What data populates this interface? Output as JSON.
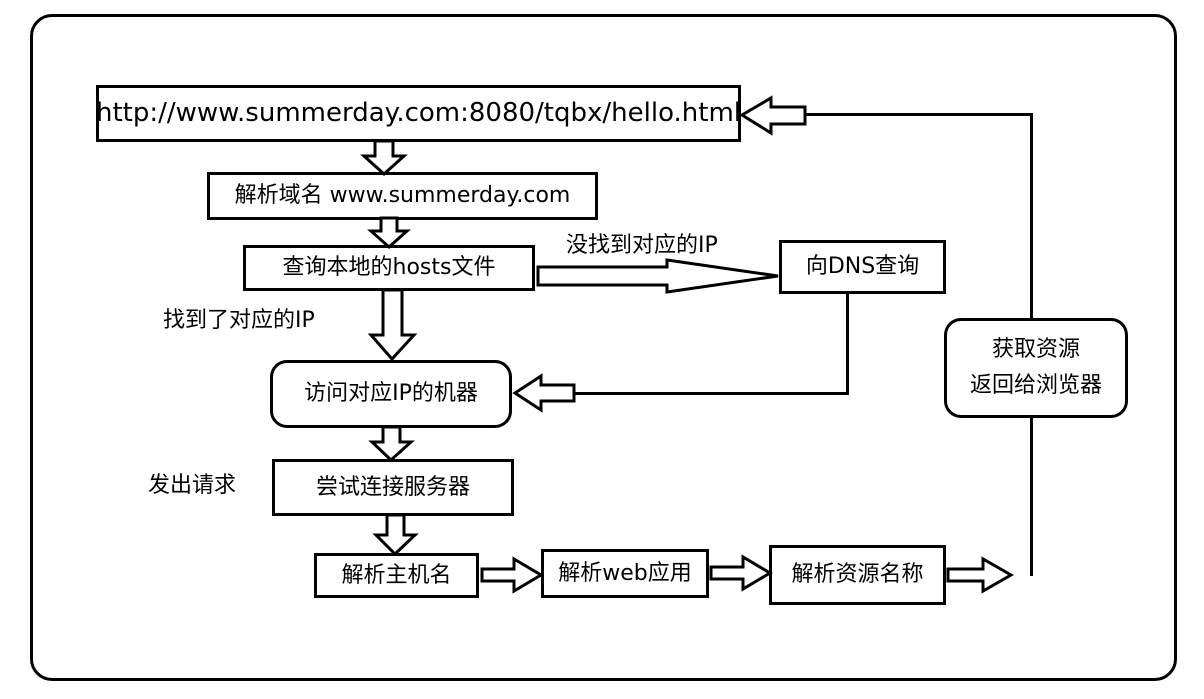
{
  "diagram": {
    "title": "HTTP request resolution flowchart",
    "stroke_color": "#000000",
    "background_color": "#ffffff",
    "nodes": {
      "url": "http://www.summerday.com:8080/tqbx/hello.html",
      "resolve_domain": "解析域名 www.summerday.com",
      "query_hosts": "查询本地的hosts文件",
      "dns_query": "向DNS查询",
      "visit_ip_machine": "访问对应IP的机器",
      "try_connect_server": "尝试连接服务器",
      "parse_hostname": "解析主机名",
      "parse_web_app": "解析web应用",
      "parse_resource_name": "解析资源名称",
      "fetch_resource_line1": "获取资源",
      "fetch_resource_line2": "返回给浏览器"
    },
    "edge_labels": {
      "not_found_ip": "没找到对应的IP",
      "found_ip": "找到了对应的IP",
      "send_request": "发出请求"
    }
  }
}
